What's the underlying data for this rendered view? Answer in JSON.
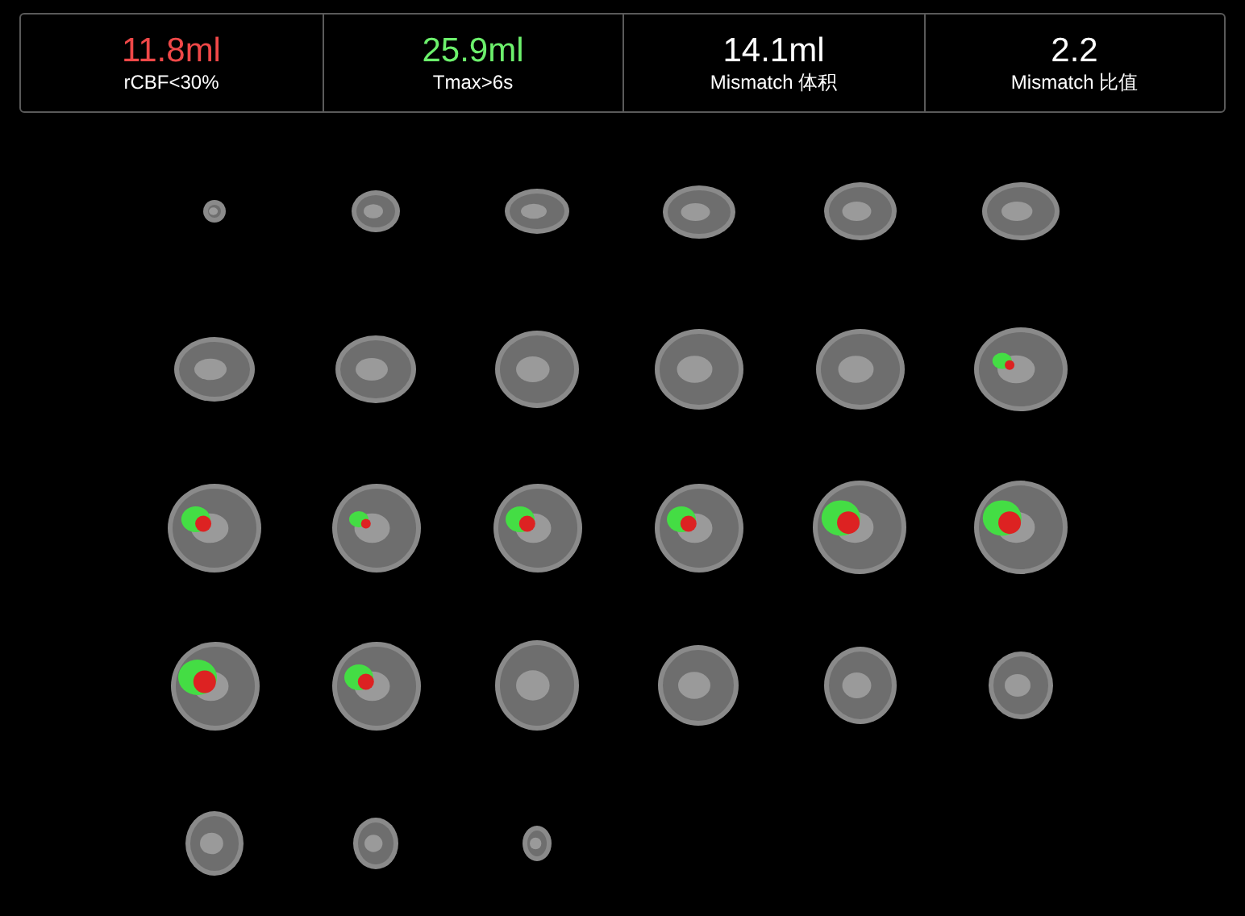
{
  "metrics": [
    {
      "value": "11.8ml",
      "label": "rCBF<30%",
      "color": "#f04848"
    },
    {
      "value": "25.9ml",
      "label": "Tmax>6s",
      "color": "#6cf06c"
    },
    {
      "value": "14.1ml",
      "label": "Mismatch 体积",
      "color": "#ffffff"
    },
    {
      "value": "2.2",
      "label": "Mismatch 比值",
      "color": "#ffffff"
    }
  ]
}
